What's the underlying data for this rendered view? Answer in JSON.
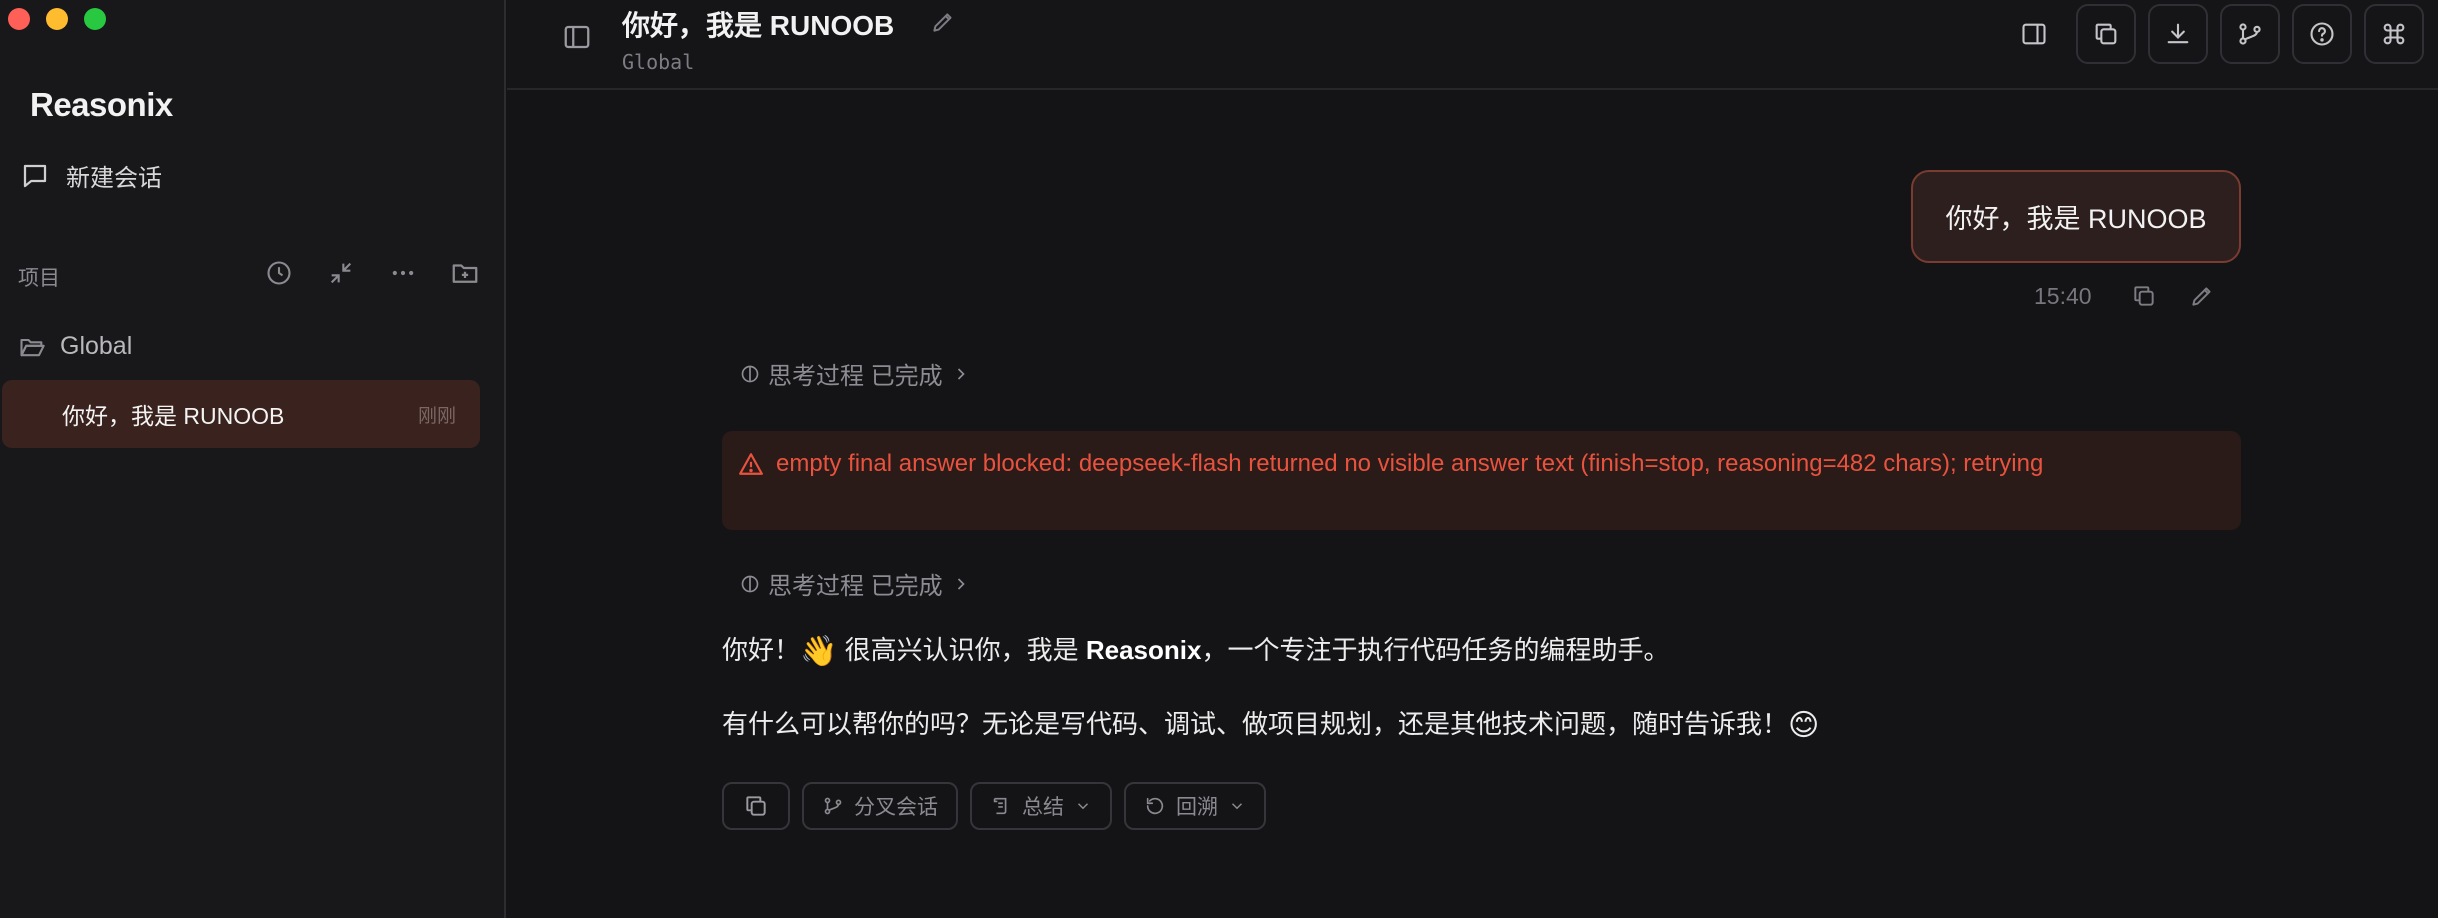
{
  "app": {
    "name": "Reasonix"
  },
  "sidebar": {
    "new_chat": "新建会话",
    "section_label": "项目",
    "section_icons": [
      "history-icon",
      "collapse-icon",
      "more-icon",
      "new-folder-icon"
    ],
    "folder": "Global",
    "conversations": [
      {
        "title": "你好，我是 RUNOOB",
        "time": "刚刚",
        "active": true
      }
    ]
  },
  "topbar": {
    "title": "你好，我是 RUNOOB",
    "subtitle": "Global",
    "actions": [
      "panel-icon",
      "copy-icon",
      "download-icon",
      "branch-icon",
      "help-icon",
      "command-icon"
    ]
  },
  "chat": {
    "user_message": {
      "text": "你好，我是 RUNOOB",
      "time": "15:40"
    },
    "thinking_label": "思考过程 已完成",
    "error": "empty final answer blocked: deepseek-flash returned no visible answer text (finish=stop, reasoning=482 chars); retrying",
    "reply": {
      "line1_pre": "你好！",
      "line1_emoji": "👋",
      "line1_mid": " 很高兴认识你，我是 ",
      "line1_bold": "Reasonix",
      "line1_post": "，一个专注于执行代码任务的编程助手。",
      "line2": "有什么可以帮你的吗？无论是写代码、调试、做项目规划，还是其他技术问题，随时告诉我！",
      "line2_emoji": "😊"
    },
    "actions": {
      "branch": "分叉会话",
      "summary": "总结",
      "rewind": "回溯"
    }
  },
  "colors": {
    "accent": "#e8533f",
    "active_item": "#3a221e",
    "bubble_border": "#7a3c30"
  }
}
